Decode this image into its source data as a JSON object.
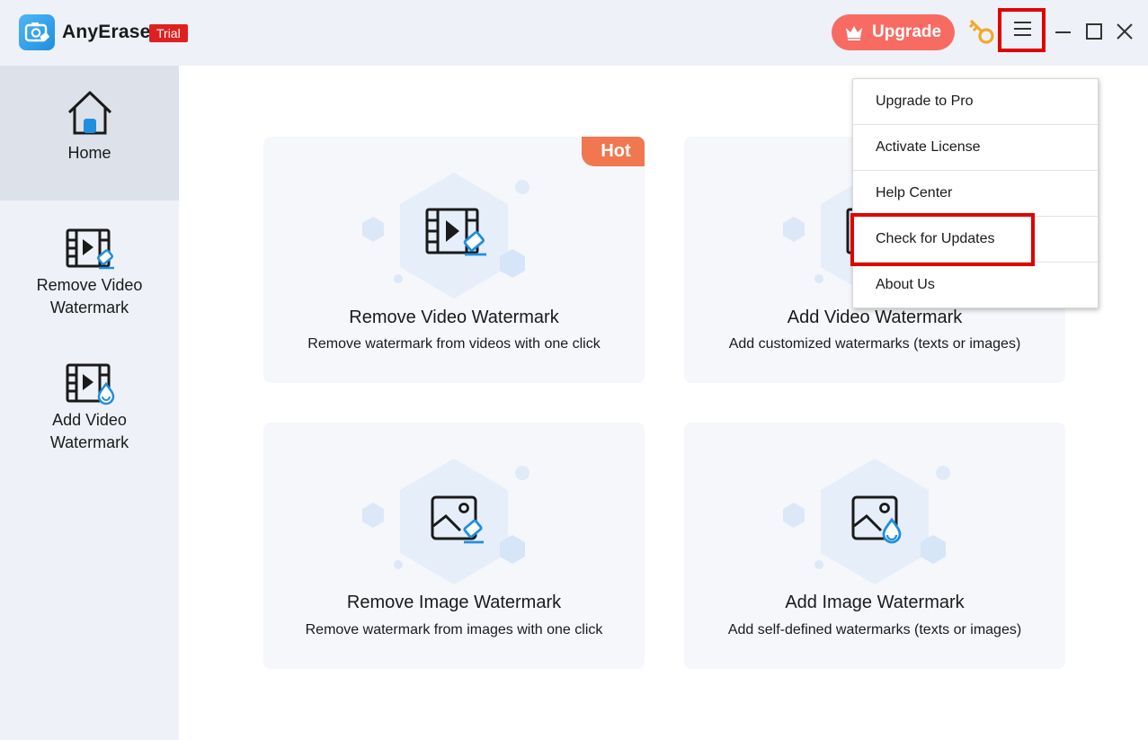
{
  "app": {
    "name": "AnyErase",
    "badge": "Trial",
    "logo_icon": "camera-eraser-icon"
  },
  "header": {
    "upgrade_label": "Upgrade",
    "upgrade_icon": "crown-icon",
    "key_icon": "key-icon",
    "menu_icon": "hamburger-menu-icon",
    "window_controls": [
      "minimize-icon",
      "maximize-icon",
      "close-icon"
    ]
  },
  "sidebar": {
    "items": [
      {
        "label": "Home",
        "icon": "home-icon",
        "active": true
      },
      {
        "label": "Remove Video Watermark",
        "line1": "Remove Video",
        "line2": "Watermark",
        "icon": "video-eraser-icon"
      },
      {
        "label": "Add Video Watermark",
        "line1": "Add Video",
        "line2": "Watermark",
        "icon": "video-drop-icon"
      }
    ]
  },
  "cards": [
    {
      "title": "Remove Video Watermark",
      "desc": "Remove watermark from videos with one click",
      "badge": "Hot",
      "icon": "video-eraser-icon"
    },
    {
      "title": "Add Video Watermark",
      "desc": "Add customized watermarks (texts or images)",
      "icon": "video-drop-icon"
    },
    {
      "title": "Remove Image Watermark",
      "desc": "Remove watermark from images with one click",
      "icon": "image-eraser-icon"
    },
    {
      "title": "Add Image Watermark",
      "desc": "Add self-defined watermarks  (texts or images)",
      "icon": "image-drop-icon"
    }
  ],
  "dropdown": {
    "items": [
      {
        "label": "Upgrade to Pro"
      },
      {
        "label": "Activate License"
      },
      {
        "label": "Help Center"
      },
      {
        "label": "Check for Updates",
        "highlighted": true
      },
      {
        "label": "About Us"
      }
    ]
  },
  "colors": {
    "accent": "#1f8fe0",
    "upgrade": "#f76b63",
    "hot": "#f0774f",
    "trial": "#e02020",
    "highlight": "#e00000",
    "sidebar_bg": "#eef1f7"
  }
}
